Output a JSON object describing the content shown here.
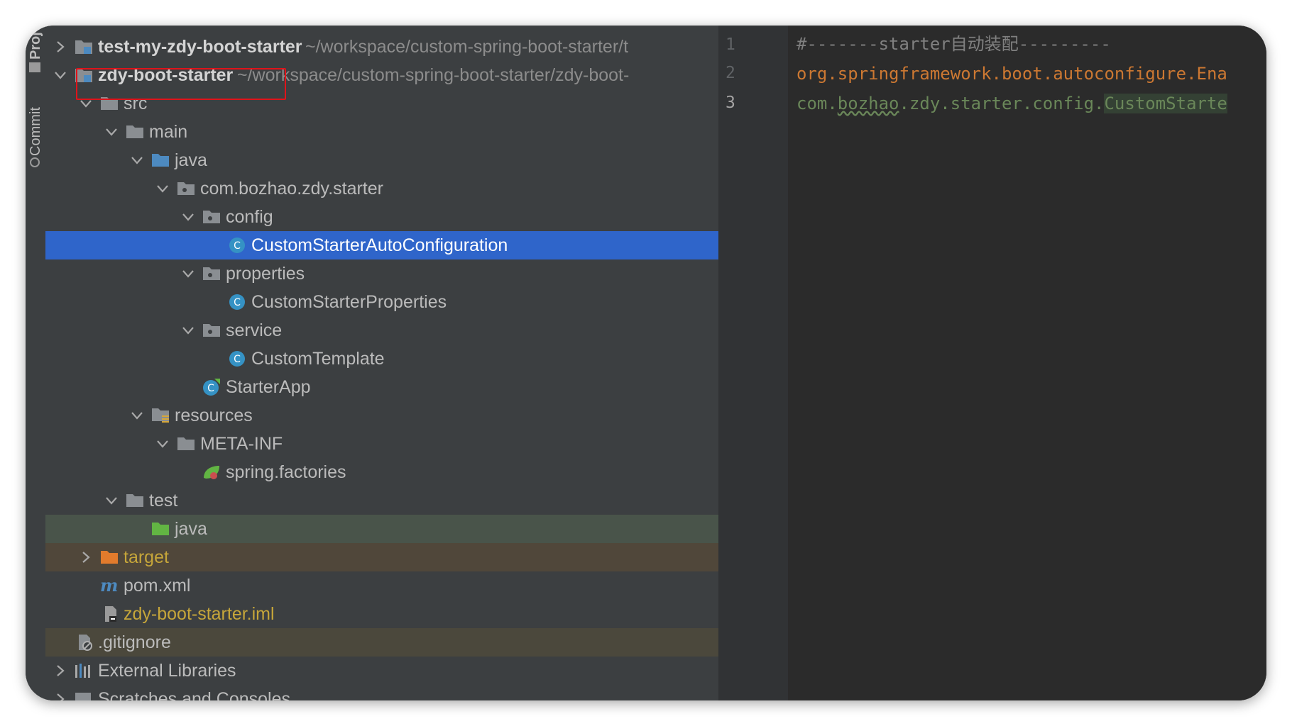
{
  "sidebar": {
    "tabs": [
      {
        "label": "Proj"
      },
      {
        "label": "Commit"
      }
    ]
  },
  "tree": {
    "rows": [
      {
        "label": "test-my-zdy-boot-starter",
        "path": "~/workspace/custom-spring-boot-starter/t"
      },
      {
        "label": "zdy-boot-starter",
        "path": "~/workspace/custom-spring-boot-starter/zdy-boot-"
      },
      {
        "label": "src"
      },
      {
        "label": "main"
      },
      {
        "label": "java"
      },
      {
        "label": "com.bozhao.zdy.starter"
      },
      {
        "label": "config"
      },
      {
        "label": "CustomStarterAutoConfiguration"
      },
      {
        "label": "properties"
      },
      {
        "label": "CustomStarterProperties"
      },
      {
        "label": "service"
      },
      {
        "label": "CustomTemplate"
      },
      {
        "label": "StarterApp"
      },
      {
        "label": "resources"
      },
      {
        "label": "META-INF"
      },
      {
        "label": "spring.factories"
      },
      {
        "label": "test"
      },
      {
        "label": "java"
      },
      {
        "label": "target"
      },
      {
        "label": "pom.xml"
      },
      {
        "label": "zdy-boot-starter.iml"
      },
      {
        "label": ".gitignore"
      },
      {
        "label": "External Libraries"
      },
      {
        "label": "Scratches and Consoles"
      }
    ]
  },
  "editor": {
    "line_numbers": [
      "1",
      "2",
      "3"
    ],
    "lines": [
      {
        "comment": "#-------starter自动装配---------"
      },
      {
        "key": "org.springframework.boot.autoconfigure.Ena"
      },
      {
        "pre": "com.",
        "squig": "bozhao",
        "mid": ".zdy.starter.config.",
        "hl": "CustomStarte"
      }
    ]
  },
  "colors": {
    "selection": "#2f65ca",
    "annotation_box": "#e0131a",
    "folder": "#8a8e92",
    "source_folder": "#4d8ac0",
    "test_folder": "#62b543",
    "excluded_folder": "#e27b2c",
    "class_icon": "#3592c4"
  }
}
